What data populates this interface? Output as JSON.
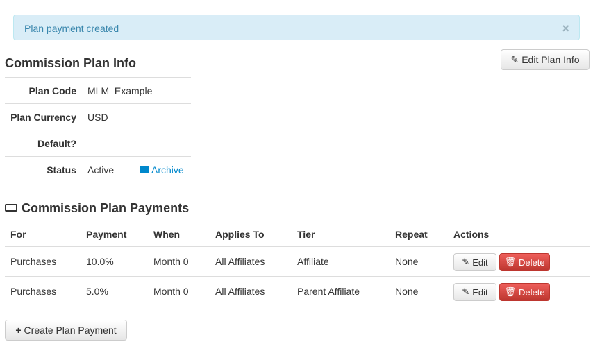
{
  "alert": {
    "message": "Plan payment created",
    "close": "×"
  },
  "info": {
    "title": "Commission Plan Info",
    "edit_button": "Edit Plan Info",
    "rows": [
      {
        "label": "Plan Code",
        "value": "MLM_Example"
      },
      {
        "label": "Plan Currency",
        "value": "USD"
      },
      {
        "label": "Default?",
        "value": ""
      },
      {
        "label": "Status",
        "value": "Active"
      }
    ],
    "archive_link": "Archive"
  },
  "payments": {
    "title": "Commission Plan Payments",
    "columns": [
      "For",
      "Payment",
      "When",
      "Applies To",
      "Tier",
      "Repeat",
      "Actions"
    ],
    "rows": [
      {
        "for": "Purchases",
        "payment": "10.0%",
        "when": "Month 0",
        "applies_to": "All Affiliates",
        "tier": "Affiliate",
        "repeat": "None"
      },
      {
        "for": "Purchases",
        "payment": "5.0%",
        "when": "Month 0",
        "applies_to": "All Affiliates",
        "tier": "Parent Affiliate",
        "repeat": "None"
      }
    ],
    "edit_label": "Edit",
    "delete_label": "Delete",
    "create_button": "Create Plan Payment"
  },
  "colors": {
    "alert_bg": "#d9edf7",
    "link": "#0088cc",
    "danger": "#da4f49"
  }
}
